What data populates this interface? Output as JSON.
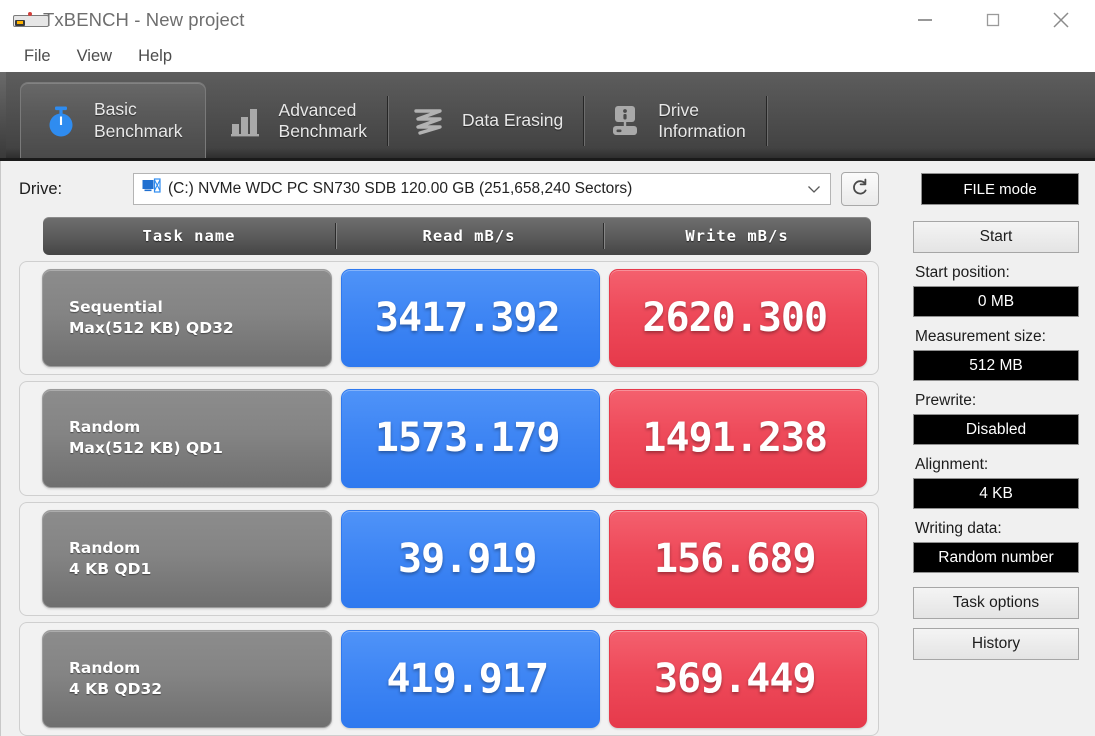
{
  "window": {
    "title": "TxBENCH - New project",
    "app_icon": "drive-device-icon",
    "controls": {
      "minimize": "minimize-icon",
      "maximize": "maximize-icon",
      "close": "close-icon"
    }
  },
  "menu": {
    "items": [
      {
        "label": "File"
      },
      {
        "label": "View"
      },
      {
        "label": "Help"
      }
    ]
  },
  "tabs": [
    {
      "label_line1": "Basic",
      "label_line2": "Benchmark",
      "icon": "stopwatch-icon",
      "active": true
    },
    {
      "label_line1": "Advanced",
      "label_line2": "Benchmark",
      "icon": "bar-chart-icon",
      "active": false
    },
    {
      "label_line1": "Data Erasing",
      "label_line2": "",
      "icon": "scribble-erase-icon",
      "active": false
    },
    {
      "label_line1": "Drive",
      "label_line2": "Information",
      "icon": "drive-info-icon",
      "active": false
    }
  ],
  "drive": {
    "label": "Drive:",
    "icon": "drive-select-icon",
    "selected": "(C:) NVMe WDC PC SN730 SDB  120.00 GB (251,658,240 Sectors)",
    "dropdown_icon": "chevron-down-icon",
    "refresh_icon": "refresh-icon",
    "mode_button": "FILE mode"
  },
  "table": {
    "headers": [
      "Task name",
      "Read mB/s",
      "Write mB/s"
    ],
    "rows": [
      {
        "task_line1": "Sequential",
        "task_line2": "Max(512 KB) QD32",
        "read": "3417.392",
        "write": "2620.300"
      },
      {
        "task_line1": "Random",
        "task_line2": "Max(512 KB) QD1",
        "read": "1573.179",
        "write": "1491.238"
      },
      {
        "task_line1": "Random",
        "task_line2": "4 KB QD1",
        "read": "39.919",
        "write": "156.689"
      },
      {
        "task_line1": "Random",
        "task_line2": "4 KB QD32",
        "read": "419.917",
        "write": "369.449"
      }
    ]
  },
  "sidebar": {
    "start_button": "Start",
    "start_position_label": "Start position:",
    "start_position_value": "0 MB",
    "measurement_size_label": "Measurement size:",
    "measurement_size_value": "512 MB",
    "prewrite_label": "Prewrite:",
    "prewrite_value": "Disabled",
    "alignment_label": "Alignment:",
    "alignment_value": "4 KB",
    "writing_data_label": "Writing data:",
    "writing_data_value": "Random number",
    "task_options_button": "Task options",
    "history_button": "History"
  },
  "colors": {
    "read_accent": "#3f86f4",
    "write_accent": "#ee4a5a",
    "task_cell": "#848484",
    "tabstrip": "#505050",
    "field_bg": "#000000"
  },
  "chart_data": {
    "type": "bar",
    "title": "TxBENCH Basic Benchmark Results",
    "categories": [
      "Sequential Max(512 KB) QD32",
      "Random Max(512 KB) QD1",
      "Random 4 KB QD1",
      "Random 4 KB QD32"
    ],
    "series": [
      {
        "name": "Read mB/s",
        "values": [
          3417.392,
          1573.179,
          39.919,
          419.917
        ]
      },
      {
        "name": "Write mB/s",
        "values": [
          2620.3,
          1491.238,
          156.689,
          369.449
        ]
      }
    ],
    "xlabel": "Task name",
    "ylabel": "mB/s",
    "legend": [
      "Read mB/s",
      "Write mB/s"
    ],
    "grid": false
  }
}
